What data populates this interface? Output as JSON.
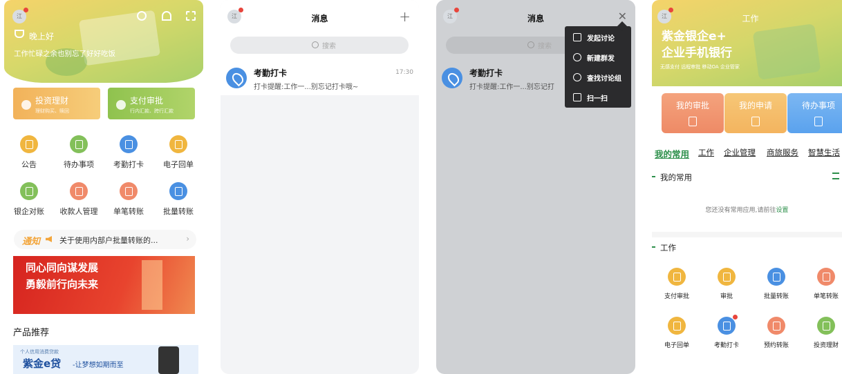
{
  "screen1": {
    "avatar": "江",
    "greeting": "晚上好",
    "subgreeting": "工作忙碌之余也别忘了好好吃饭",
    "quick": [
      {
        "title": "投资理财",
        "sub": "理财购买、赎回",
        "color": "#f2b25a"
      },
      {
        "title": "支付审批",
        "sub": "行内汇款、跨行汇款",
        "color": "#8fc24e"
      }
    ],
    "grid": [
      {
        "label": "公告",
        "icon": "announcement-icon",
        "color": "#f0b63f"
      },
      {
        "label": "待办事项",
        "icon": "todo-icon",
        "color": "#83c05a"
      },
      {
        "label": "考勤打卡",
        "icon": "location-pin-icon",
        "color": "#4a90e2"
      },
      {
        "label": "电子回单",
        "icon": "receipt-icon",
        "color": "#f0b63f"
      },
      {
        "label": "银企对账",
        "icon": "reconcile-icon",
        "color": "#83c05a"
      },
      {
        "label": "收款人管理",
        "icon": "payee-icon",
        "color": "#f08a6a"
      },
      {
        "label": "单笔转账",
        "icon": "single-transfer-icon",
        "color": "#f08a6a"
      },
      {
        "label": "批量转账",
        "icon": "batch-transfer-icon",
        "color": "#4a90e2"
      }
    ],
    "notice_tag": "通知",
    "notice_text": "关于使用内部户批量转账的...",
    "banner_line1": "同心同向谋发展",
    "banner_line2": "勇毅前行向未来",
    "section_title": "产品推荐",
    "promo_small": "个人信用消费贷款",
    "promo_big": "紫金e贷",
    "promo_sub": "-让梦想如期而至"
  },
  "screen2": {
    "avatar": "江",
    "title": "消息",
    "search_placeholder": "搜索",
    "chat": {
      "name": "考勤打卡",
      "message": "打卡提醒:工作一...别忘记打卡哦~",
      "time": "17:30"
    }
  },
  "screen3": {
    "avatar": "江",
    "title": "消息",
    "search_placeholder": "搜索",
    "chat": {
      "name": "考勤打卡",
      "message": "打卡提醒:工作一...别忘记打"
    },
    "menu": [
      {
        "label": "发起讨论",
        "icon": "chat-bubble-icon"
      },
      {
        "label": "新建群发",
        "icon": "group-icon"
      },
      {
        "label": "查找讨论组",
        "icon": "search-icon"
      },
      {
        "label": "扫一扫",
        "icon": "scan-icon"
      }
    ]
  },
  "screen4": {
    "avatar": "江",
    "title": "工作",
    "brand1": "紫金银企e+",
    "brand2": "企业手机银行",
    "brand_sub": "无感支付 远程审批 移动OA 企业管家",
    "cards": [
      {
        "label": "我的审批",
        "icon": "approval-icon"
      },
      {
        "label": "我的申请",
        "icon": "application-icon"
      },
      {
        "label": "待办事项",
        "icon": "todo-icon"
      }
    ],
    "tabs": [
      "我的常用",
      "工作",
      "企业管理",
      "商旅服务",
      "智慧生活"
    ],
    "section_common": "我的常用",
    "empty_text": "您还没有常用应用,请前往",
    "empty_link": "设置",
    "section_work": "工作",
    "work_items": [
      {
        "label": "支付审批",
        "icon": "pay-approval-icon",
        "color": "#f0b63f"
      },
      {
        "label": "审批",
        "icon": "approval-icon",
        "color": "#f0b63f"
      },
      {
        "label": "批量转账",
        "icon": "batch-transfer-icon",
        "color": "#4a90e2"
      },
      {
        "label": "单笔转账",
        "icon": "single-transfer-icon",
        "color": "#f08a6a"
      },
      {
        "label": "电子回单",
        "icon": "receipt-icon",
        "color": "#f0b63f"
      },
      {
        "label": "考勤打卡",
        "icon": "location-pin-icon",
        "color": "#4a90e2"
      },
      {
        "label": "预约转账",
        "icon": "scheduled-transfer-icon",
        "color": "#f08a6a"
      },
      {
        "label": "投资理财",
        "icon": "investment-icon",
        "color": "#83c05a"
      }
    ]
  }
}
